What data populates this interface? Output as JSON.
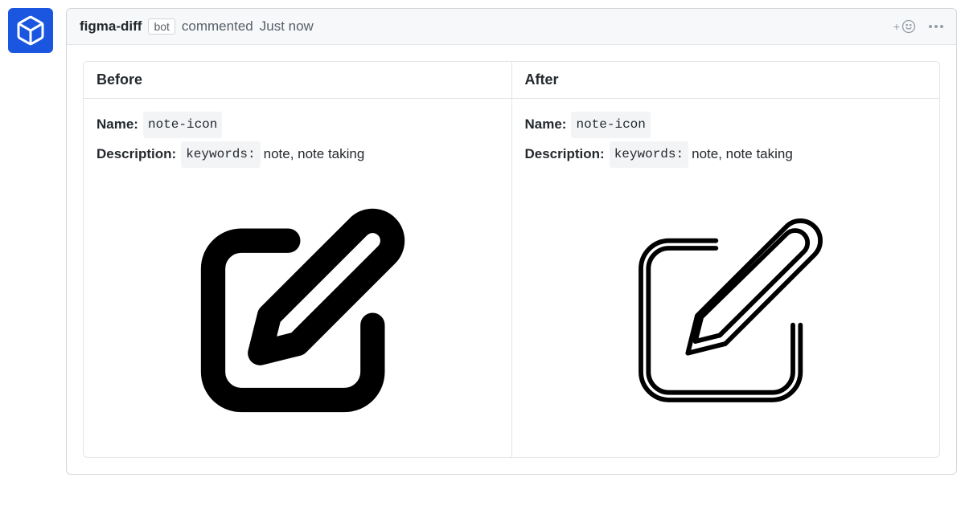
{
  "author": "figma-diff",
  "bot_label": "bot",
  "action_text": "commented",
  "timestamp": "Just now",
  "columns": {
    "before": {
      "header": "Before",
      "name_label": "Name:",
      "name_value": "note-icon",
      "desc_label": "Description:",
      "desc_key": "keywords:",
      "desc_value": "note, note taking"
    },
    "after": {
      "header": "After",
      "name_label": "Name:",
      "name_value": "note-icon",
      "desc_label": "Description:",
      "desc_key": "keywords:",
      "desc_value": "note, note taking"
    }
  },
  "colors": {
    "avatar_bg": "#1b56e0",
    "border": "#d1d5da",
    "header_bg": "#f6f8fa"
  }
}
